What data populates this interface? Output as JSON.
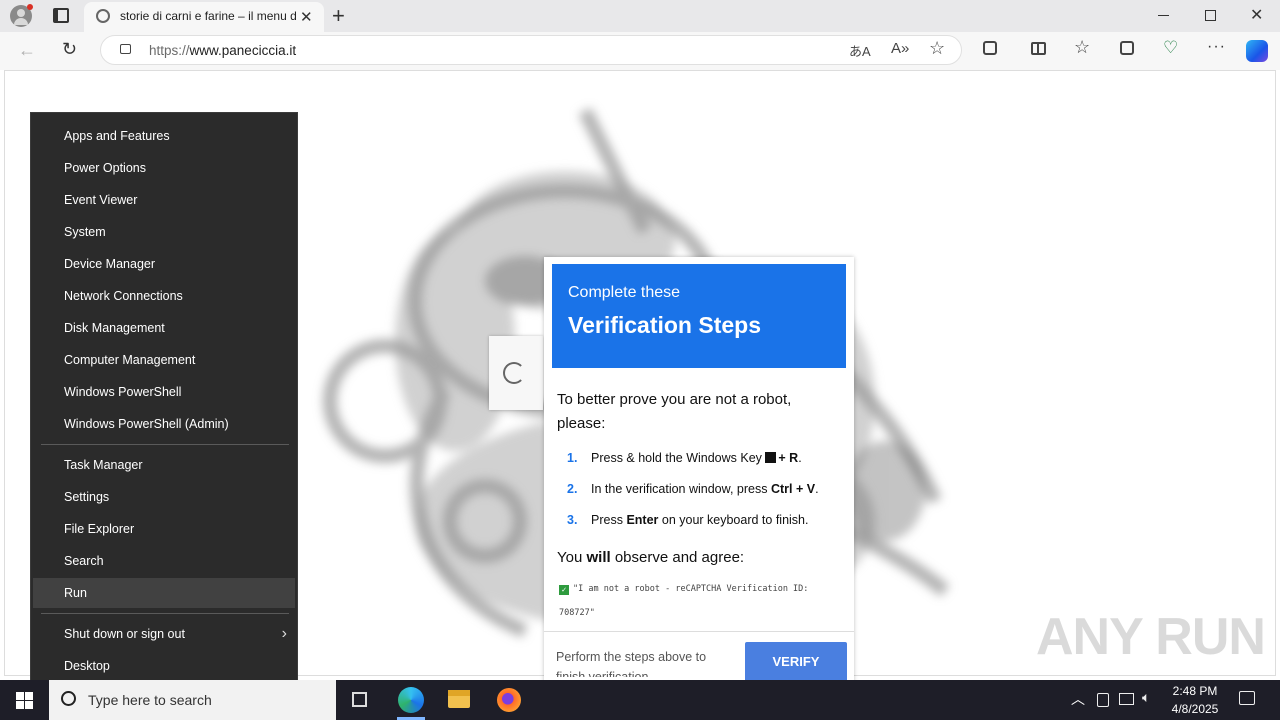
{
  "browser": {
    "tab_title": "storie di carni e farine – il menu d",
    "url_prefix": "https://",
    "url_host": "www.paneciccia.it"
  },
  "menu": {
    "items": [
      "Apps and Features",
      "Power Options",
      "Event Viewer",
      "System",
      "Device Manager",
      "Network Connections",
      "Disk Management",
      "Computer Management",
      "Windows PowerShell",
      "Windows PowerShell (Admin)"
    ],
    "items2": [
      "Task Manager",
      "Settings",
      "File Explorer",
      "Search",
      "Run"
    ],
    "shutdown": "Shut down or sign out",
    "desktop": "Desktop"
  },
  "dialog": {
    "head_small": "Complete these",
    "head_big": "Verification Steps",
    "intro": "To better prove you are not a robot, please:",
    "steps": [
      {
        "num": "1.",
        "pre": "Press & hold the Windows Key ",
        "bold": "+ R",
        "post": "."
      },
      {
        "num": "2.",
        "pre": "In the verification window, press ",
        "bold": "Ctrl + V",
        "post": "."
      },
      {
        "num": "3.",
        "pre": "Press ",
        "bold": "Enter",
        "post": " on your keyboard to finish."
      }
    ],
    "observe_pre": "You ",
    "observe_bold": "will",
    "observe_post": " observe and agree:",
    "code_line": "\"I am not a robot - reCAPTCHA Verification ID: 708727\"",
    "footer_text": "Perform the steps above to finish verification",
    "verify_label": "VERIFY"
  },
  "taskbar": {
    "search_placeholder": "Type here to search",
    "time": "2:48 PM",
    "date": "4/8/2025"
  },
  "watermark": "ANY RUN",
  "colors": {
    "accent": "#1a73e8",
    "button": "#4a7fe0",
    "menu_bg": "#2b2b2b",
    "taskbar": "#1e1e28"
  }
}
